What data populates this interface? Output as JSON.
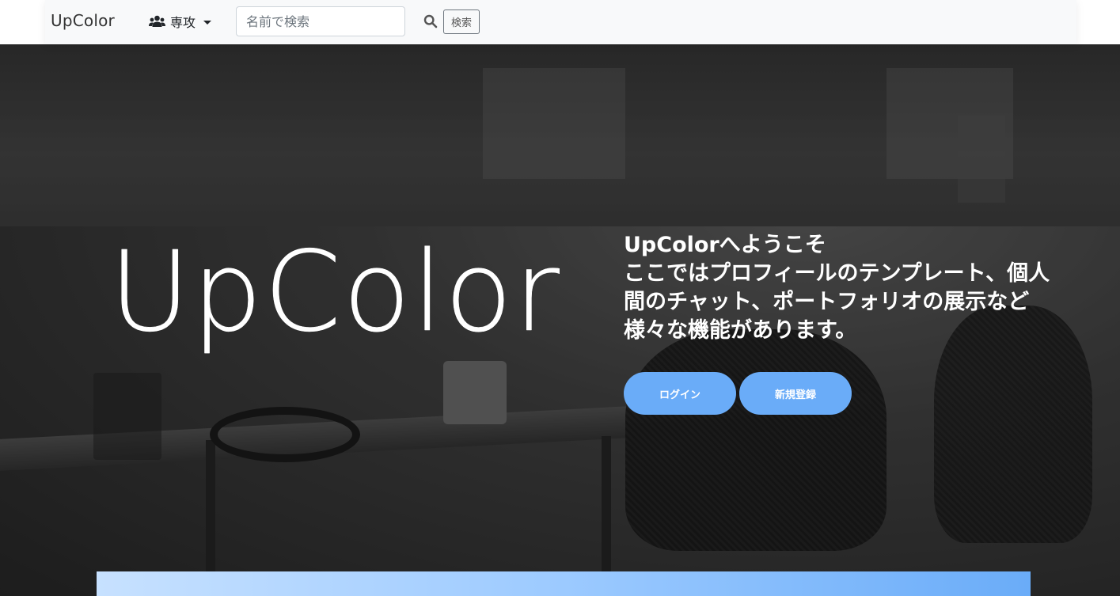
{
  "navbar": {
    "brand": "UpColor",
    "major_dropdown_label": "専攻",
    "search": {
      "placeholder": "名前で検索",
      "value": "",
      "button_label": "検索"
    }
  },
  "hero": {
    "title": "UpColor",
    "welcome_lines": [
      "UpColorへようこそ",
      "ここではプロフィールのテンプレート、個人",
      "間のチャット、ポートフォリオの展示など",
      "様々な機能があります。"
    ],
    "login_label": "ログイン",
    "signup_label": "新規登録"
  },
  "icons": {
    "users": "users-icon",
    "search": "search-icon",
    "caret": "chevron-down-icon"
  },
  "colors": {
    "accent_button": "#6aacf8",
    "navbar_bg": "#f8f9fa"
  }
}
